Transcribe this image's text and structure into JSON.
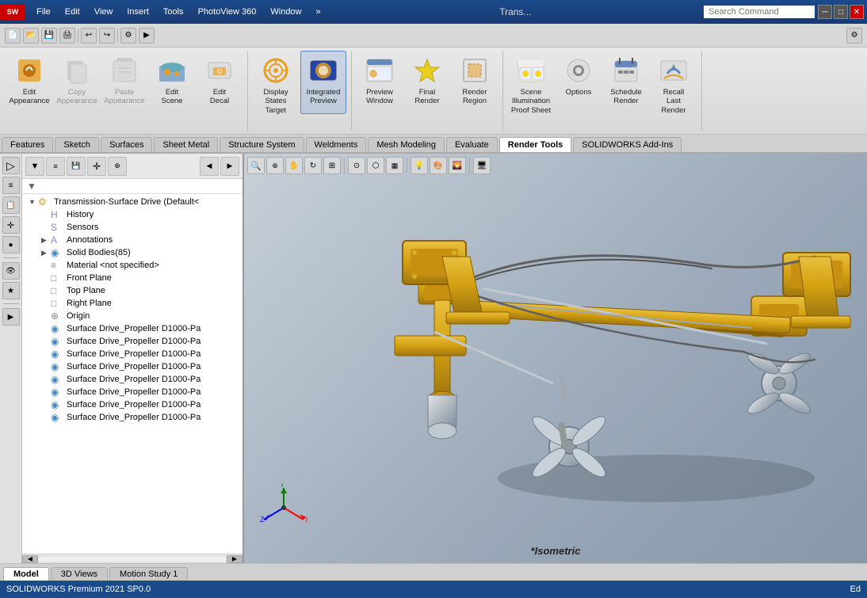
{
  "app": {
    "name": "SOLIDWORKS",
    "edition": "SOLIDWORKS Premium 2021 SP0.0",
    "document_title": "Transmission-Surface Drive (Default",
    "status_right": "Ed"
  },
  "titlebar": {
    "logo": "SOLIDWORKS",
    "menu": [
      "File",
      "Edit",
      "View",
      "Insert",
      "Tools",
      "PhotoView 360",
      "Window"
    ],
    "search_placeholder": "Search Command",
    "window_controls": [
      "─",
      "□",
      "✕"
    ]
  },
  "ribbon": {
    "groups": [
      {
        "name": "appearance-group",
        "buttons": [
          {
            "id": "edit-appearance",
            "label": "Edit\nAppearance",
            "icon": "🎨",
            "active": false,
            "disabled": false
          },
          {
            "id": "copy-appearance",
            "label": "Copy\nAppearance",
            "icon": "📋",
            "active": false,
            "disabled": true
          },
          {
            "id": "paste-appearance",
            "label": "Paste\nAppearance",
            "icon": "📌",
            "active": false,
            "disabled": true
          },
          {
            "id": "edit-scene",
            "label": "Edit\nScene",
            "icon": "🌄",
            "active": false,
            "disabled": false
          },
          {
            "id": "edit-decal",
            "label": "Edit\nDecal",
            "icon": "🏷️",
            "active": false,
            "disabled": false
          }
        ]
      },
      {
        "name": "states-group",
        "buttons": [
          {
            "id": "display-states-target",
            "label": "Display\nStates\nTarget",
            "icon": "🎯",
            "active": false,
            "disabled": false
          },
          {
            "id": "integrated-preview",
            "label": "Integrated\nPreview",
            "icon": "👁️",
            "active": true,
            "disabled": false
          }
        ]
      },
      {
        "name": "render-group",
        "buttons": [
          {
            "id": "preview-window",
            "label": "Preview\nWindow",
            "icon": "🖼️",
            "active": false,
            "disabled": false
          },
          {
            "id": "final-render",
            "label": "Final\nRender",
            "icon": "⚡",
            "active": false,
            "disabled": false
          },
          {
            "id": "render-region",
            "label": "Render\nRegion",
            "icon": "▦",
            "active": false,
            "disabled": false
          }
        ]
      },
      {
        "name": "scene-group",
        "buttons": [
          {
            "id": "scene-illumination",
            "label": "Scene\nIllumination\nProof Sheet",
            "icon": "💡",
            "active": false,
            "disabled": false
          },
          {
            "id": "options",
            "label": "Options",
            "icon": "⚙️",
            "active": false,
            "disabled": false
          },
          {
            "id": "schedule-render",
            "label": "Schedule\nRender",
            "icon": "📅",
            "active": false,
            "disabled": false
          },
          {
            "id": "recall-last-render",
            "label": "Recall\nLast\nRender",
            "icon": "↩️",
            "active": false,
            "disabled": false
          }
        ]
      }
    ]
  },
  "tabs": {
    "items": [
      "Features",
      "Sketch",
      "Surfaces",
      "Sheet Metal",
      "Structure System",
      "Weldments",
      "Mesh Modeling",
      "Evaluate",
      "Render Tools",
      "SOLIDWORKS Add-Ins"
    ],
    "active": "Render Tools"
  },
  "feature_tree": {
    "root": "Transmission-Surface Drive  (Default<",
    "items": [
      {
        "id": "history",
        "label": "History",
        "icon": "H",
        "indent": 1,
        "expandable": false
      },
      {
        "id": "sensors",
        "label": "Sensors",
        "icon": "S",
        "indent": 1,
        "expandable": false
      },
      {
        "id": "annotations",
        "label": "Annotations",
        "icon": "A",
        "indent": 1,
        "expandable": true
      },
      {
        "id": "solid-bodies",
        "label": "Solid Bodies(85)",
        "icon": "B",
        "indent": 1,
        "expandable": true
      },
      {
        "id": "material",
        "label": "Material <not specified>",
        "icon": "M",
        "indent": 1,
        "expandable": false
      },
      {
        "id": "front-plane",
        "label": "Front Plane",
        "icon": "P",
        "indent": 1,
        "expandable": false
      },
      {
        "id": "top-plane",
        "label": "Top Plane",
        "icon": "P",
        "indent": 1,
        "expandable": false
      },
      {
        "id": "right-plane",
        "label": "Right Plane",
        "icon": "P",
        "indent": 1,
        "expandable": false
      },
      {
        "id": "origin",
        "label": "Origin",
        "icon": "O",
        "indent": 1,
        "expandable": false
      },
      {
        "id": "part1",
        "label": "Surface Drive_Propeller D1000-Pa",
        "icon": "C",
        "indent": 1,
        "expandable": false
      },
      {
        "id": "part2",
        "label": "Surface Drive_Propeller D1000-Pa",
        "icon": "C",
        "indent": 1,
        "expandable": false
      },
      {
        "id": "part3",
        "label": "Surface Drive_Propeller D1000-Pa",
        "icon": "C",
        "indent": 1,
        "expandable": false
      },
      {
        "id": "part4",
        "label": "Surface Drive_Propeller D1000-Pa",
        "icon": "C",
        "indent": 1,
        "expandable": false
      },
      {
        "id": "part5",
        "label": "Surface Drive_Propeller D1000-Pa",
        "icon": "C",
        "indent": 1,
        "expandable": false
      },
      {
        "id": "part6",
        "label": "Surface Drive_Propeller D1000-Pa",
        "icon": "C",
        "indent": 1,
        "expandable": false
      },
      {
        "id": "part7",
        "label": "Surface Drive_Propeller D1000-Pa",
        "icon": "C",
        "indent": 1,
        "expandable": false
      },
      {
        "id": "part8",
        "label": "Surface Drive_Propeller D1000-Pa",
        "icon": "C",
        "indent": 1,
        "expandable": false
      }
    ]
  },
  "viewport": {
    "view_label": "*Isometric",
    "toolbar_buttons": [
      "🔍",
      "🔎",
      "↔",
      "⊞",
      "🔄",
      "📐",
      "👁",
      "◉",
      "🎨",
      "💡",
      "🖥"
    ]
  },
  "bottom_tabs": {
    "items": [
      "Model",
      "3D Views",
      "Motion Study 1"
    ],
    "active": "Model"
  },
  "left_toolbar": {
    "buttons": [
      "▷",
      "≡",
      "📋",
      "✛",
      "🔘",
      "⚡",
      "🔲",
      "📏",
      "🗒"
    ]
  }
}
